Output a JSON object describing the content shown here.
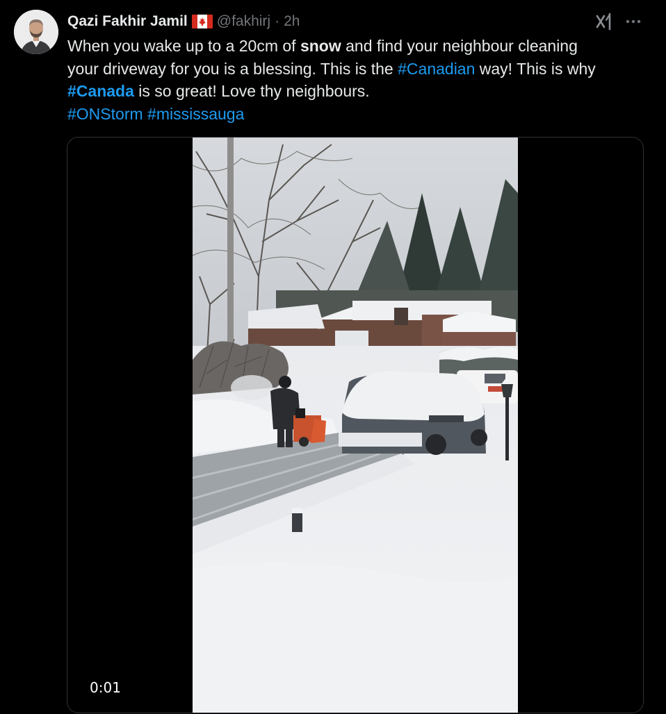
{
  "tweet": {
    "author_name": "Qazi Fakhir Jamil",
    "author_flag": "canada-flag-icon",
    "handle": "@fakhirj",
    "separator": "·",
    "time": "2h",
    "text": {
      "line1_a": "When you wake up to a 20cm of ",
      "line1_b": "snow",
      "line1_c": " and find your neighbour cleaning",
      "line2_a": "your driveway for you is a blessing. This is the ",
      "line2_tag": "#Canadian",
      "line2_b": " way! This is why",
      "line3_tag": "#Canada",
      "line3_a": " is so great! Love thy neighbours.",
      "line4_tag1": "#ONStorm",
      "line4_tag2": "#mississauga"
    }
  },
  "media": {
    "type": "video",
    "timestamp": "0:01",
    "subject": "neighbour using snowblower on driveway beside snow-covered car"
  },
  "icons": {
    "grok": "grok-icon",
    "more": "more-options-icon"
  },
  "colors": {
    "background": "#000000",
    "text": "#e7e9ea",
    "muted": "#71767b",
    "link": "#1d9bf0",
    "border": "#2f3336"
  }
}
